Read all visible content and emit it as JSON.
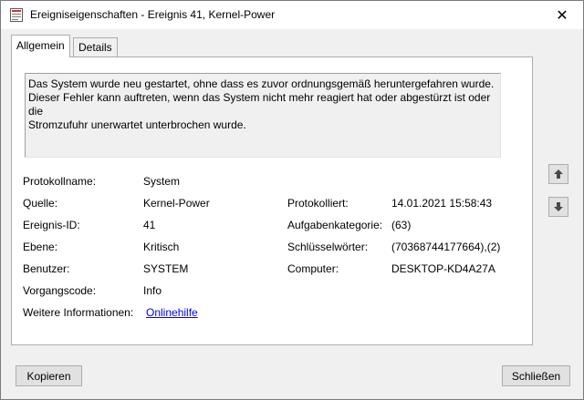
{
  "window": {
    "title": "Ereigniseigenschaften - Ereignis 41, Kernel-Power",
    "close_symbol": "✕"
  },
  "tabs": [
    {
      "label": "Allgemein",
      "active": true
    },
    {
      "label": "Details",
      "active": false
    }
  ],
  "description": "Das System wurde neu gestartet, ohne dass es zuvor ordnungsgemäß heruntergefahren wurde.\nDieser Fehler kann auftreten, wenn das System nicht mehr reagiert hat oder abgestürzt ist oder die\nStromzufuhr unerwartet unterbrochen wurde.",
  "fields": {
    "protokollname": {
      "label": "Protokollname:",
      "value": "System"
    },
    "quelle": {
      "label": "Quelle:",
      "value": "Kernel-Power"
    },
    "ereignis_id": {
      "label": "Ereignis-ID:",
      "value": "41"
    },
    "ebene": {
      "label": "Ebene:",
      "value": "Kritisch"
    },
    "benutzer": {
      "label": "Benutzer:",
      "value": "SYSTEM"
    },
    "vorgangscode": {
      "label": "Vorgangscode:",
      "value": "Info"
    },
    "weitere_informationen": {
      "label": "Weitere Informationen:",
      "value": "Onlinehilfe"
    },
    "protokolliert": {
      "label": "Protokolliert:",
      "value": "14.01.2021 15:58:43"
    },
    "aufgabenkategorie": {
      "label": "Aufgabenkategorie:",
      "value": "(63)"
    },
    "schluesselwoerter": {
      "label": "Schlüsselwörter:",
      "value": "(70368744177664),(2)"
    },
    "computer": {
      "label": "Computer:",
      "value": "DESKTOP-KD4A27A"
    }
  },
  "buttons": {
    "copy": "Kopieren",
    "close": "Schließen"
  },
  "icons": {
    "app": "event-viewer-icon",
    "up": "arrow-up-icon",
    "down": "arrow-down-icon"
  },
  "colors": {
    "link": "#0000ff",
    "window_bg": "#f0f0f0",
    "panel_bg": "#ffffff"
  }
}
